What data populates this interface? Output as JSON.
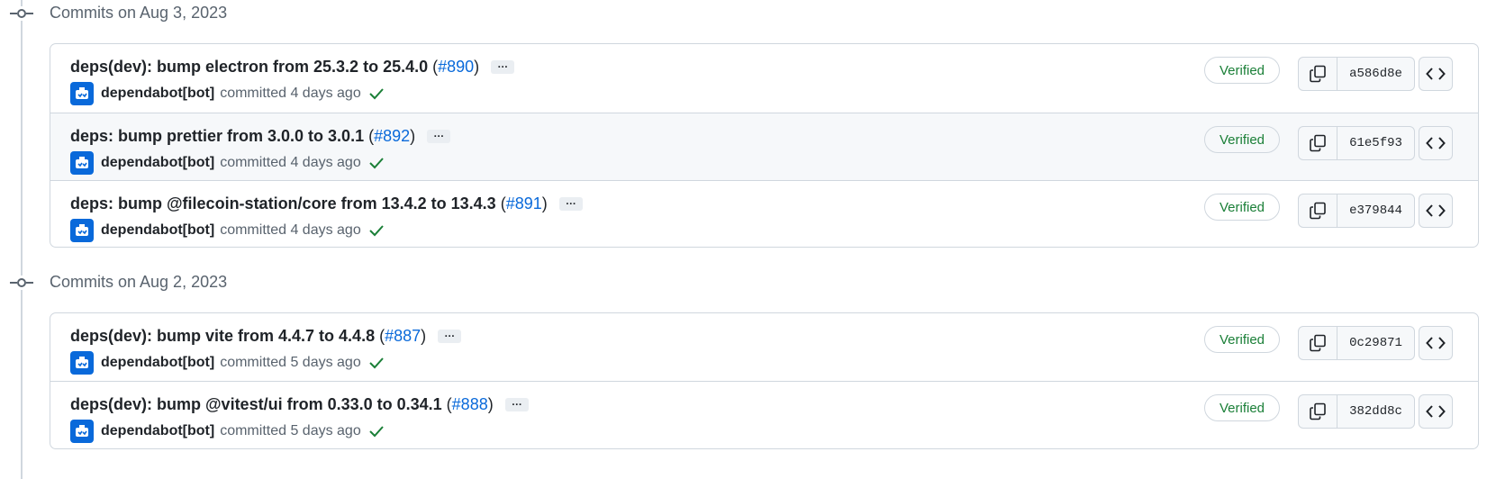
{
  "groups": [
    {
      "title": "Commits on Aug 3, 2023",
      "commits": [
        {
          "message": "deps(dev): bump electron from 25.3.2 to 25.4.0",
          "pr": "#890",
          "author": "dependabot[bot]",
          "time": "committed 4 days ago",
          "verified": "Verified",
          "sha": "a586d8e"
        },
        {
          "message": "deps: bump prettier from 3.0.0 to 3.0.1",
          "pr": "#892",
          "author": "dependabot[bot]",
          "time": "committed 4 days ago",
          "verified": "Verified",
          "sha": "61e5f93"
        },
        {
          "message": "deps: bump @filecoin-station/core from 13.4.2 to 13.4.3",
          "pr": "#891",
          "author": "dependabot[bot]",
          "time": "committed 4 days ago",
          "verified": "Verified",
          "sha": "e379844"
        }
      ]
    },
    {
      "title": "Commits on Aug 2, 2023",
      "commits": [
        {
          "message": "deps(dev): bump vite from 4.4.7 to 4.4.8",
          "pr": "#887",
          "author": "dependabot[bot]",
          "time": "committed 5 days ago",
          "verified": "Verified",
          "sha": "0c29871"
        },
        {
          "message": "deps(dev): bump @vitest/ui from 0.33.0 to 0.34.1",
          "pr": "#888",
          "author": "dependabot[bot]",
          "time": "committed 5 days ago",
          "verified": "Verified",
          "sha": "382dd8c"
        }
      ]
    }
  ],
  "ui": {
    "ellipsis": "…",
    "paren_open": "(",
    "paren_close": ")"
  },
  "icons": {
    "timeline": "git-commit-icon",
    "avatar": "dependabot-avatar-icon",
    "check": "check-icon",
    "copy": "copy-icon",
    "browse": "code-icon"
  },
  "colors": {
    "link": "#0969da",
    "verified": "#1a7f37",
    "muted": "#59636e",
    "border": "#d0d7de",
    "hover_row": "#f6f8fa"
  }
}
